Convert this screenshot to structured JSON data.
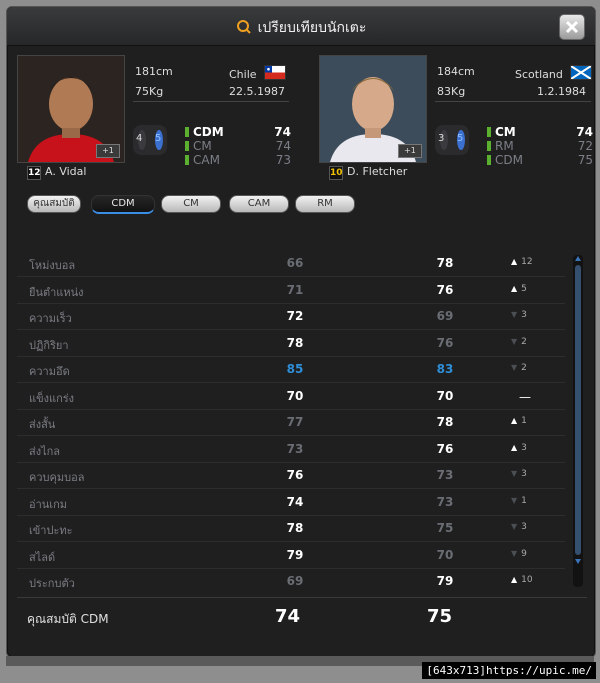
{
  "window": {
    "title": "เปรียบเทียบนักเตะ"
  },
  "player1": {
    "number": "12",
    "name": "A. Vidal",
    "height": "181cm",
    "weight": "75Kg",
    "nation": "Chile",
    "birth": "22.5.1987",
    "foot_left": "4",
    "foot_right": "5",
    "plus": "+1",
    "positions": [
      {
        "name": "CDM",
        "value": "74"
      },
      {
        "name": "CM",
        "value": "74"
      },
      {
        "name": "CAM",
        "value": "73"
      }
    ]
  },
  "player2": {
    "number": "10",
    "name": "D. Fletcher",
    "height": "184cm",
    "weight": "83Kg",
    "nation": "Scotland",
    "birth": "1.2.1984",
    "foot_left": "3",
    "foot_right": "5",
    "plus": "+1",
    "positions": [
      {
        "name": "CM",
        "value": "74"
      },
      {
        "name": "RM",
        "value": "72"
      },
      {
        "name": "CDM",
        "value": "75"
      }
    ]
  },
  "tabs": [
    "คุณสมบัติ",
    "CDM",
    "CM",
    "CAM",
    "RM"
  ],
  "stats": [
    {
      "label": "โหม่งบอล",
      "v1": "66",
      "v2": "78",
      "diff": "12",
      "dir": "up"
    },
    {
      "label": "ยืนตำแหน่ง",
      "v1": "71",
      "v2": "76",
      "diff": "5",
      "dir": "up"
    },
    {
      "label": "ความเร็ว",
      "v1": "72",
      "v2": "69",
      "diff": "3",
      "dir": "down"
    },
    {
      "label": "ปฏิกิริยา",
      "v1": "78",
      "v2": "76",
      "diff": "2",
      "dir": "down"
    },
    {
      "label": "ความอึด",
      "v1": "85",
      "v2": "83",
      "diff": "2",
      "dir": "down"
    },
    {
      "label": "แข็งแกร่ง",
      "v1": "70",
      "v2": "70",
      "diff": "",
      "dir": "eq"
    },
    {
      "label": "ส่งสั้น",
      "v1": "77",
      "v2": "78",
      "diff": "1",
      "dir": "up"
    },
    {
      "label": "ส่งไกล",
      "v1": "73",
      "v2": "76",
      "diff": "3",
      "dir": "up"
    },
    {
      "label": "ควบคุมบอล",
      "v1": "76",
      "v2": "73",
      "diff": "3",
      "dir": "down"
    },
    {
      "label": "อ่านเกม",
      "v1": "74",
      "v2": "73",
      "diff": "1",
      "dir": "down"
    },
    {
      "label": "เข้าปะทะ",
      "v1": "78",
      "v2": "75",
      "diff": "3",
      "dir": "down"
    },
    {
      "label": "สไลด์",
      "v1": "79",
      "v2": "70",
      "diff": "9",
      "dir": "down"
    },
    {
      "label": "ประกบตัว",
      "v1": "69",
      "v2": "79",
      "diff": "10",
      "dir": "up"
    }
  ],
  "summary": {
    "label": "คุณสมบัติ CDM",
    "v1": "74",
    "v2": "75"
  },
  "watermark": "[643x713]https://upic.me/",
  "colors": {
    "accent_blue": "#2e8fd8",
    "position_green": "#5cb030"
  }
}
